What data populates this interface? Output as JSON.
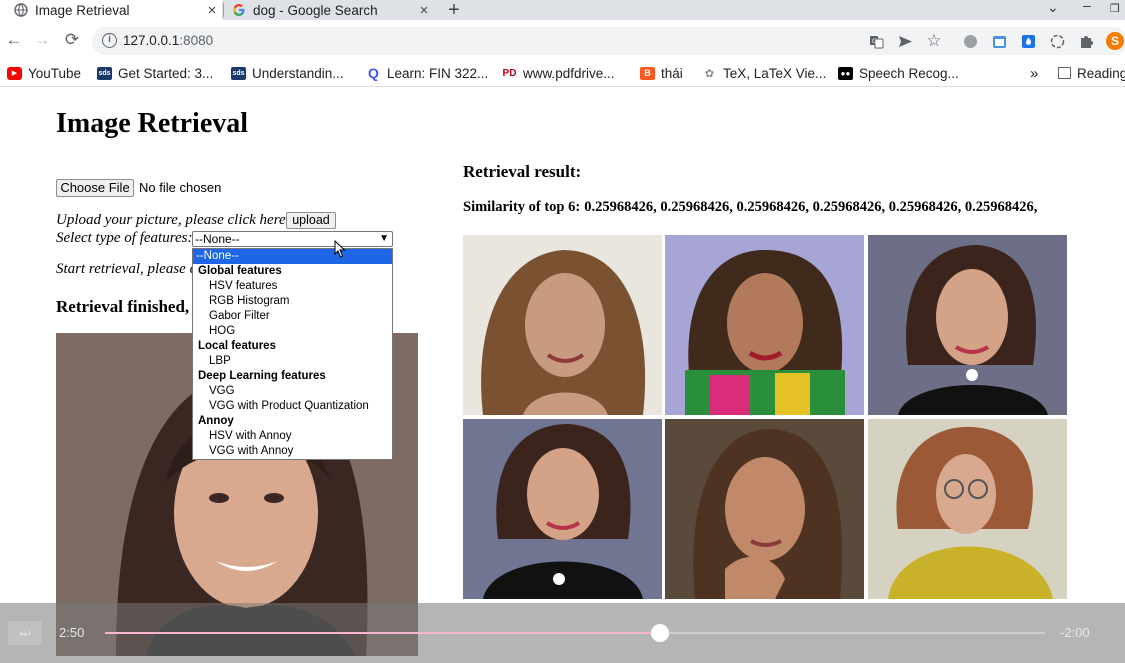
{
  "browser": {
    "tabs": [
      {
        "title": "Image Retrieval",
        "active": true,
        "close": "×",
        "icon": "globe-icon"
      },
      {
        "title": "dog - Google Search",
        "active": false,
        "close": "×",
        "icon": "google-g-icon"
      }
    ],
    "new_tab": "+",
    "url_host": "127.0.0.1",
    "url_port": ":8080",
    "bookmarks": [
      {
        "label": "YouTube",
        "icon": "youtube-icon",
        "color": "#ff0000"
      },
      {
        "label": "Get Started: 3...",
        "icon": "bookmark-favicon",
        "color": "#1a3a6b"
      },
      {
        "label": "Understandin...",
        "icon": "bookmark-favicon",
        "color": "#1a3a6b"
      },
      {
        "label": "Learn: FIN 322...",
        "icon": "quizlet-icon",
        "color": "#4255ff"
      },
      {
        "label": "www.pdfdrive...",
        "icon": "pdfdrive-icon",
        "color": "#b00020"
      },
      {
        "label": "thái",
        "icon": "blogger-icon",
        "color": "#ff5722"
      },
      {
        "label": "TeX, LaTeX Vie...",
        "icon": "tex-icon",
        "color": "#888888"
      },
      {
        "label": "Speech Recog...",
        "icon": "medium-icon",
        "color": "#000000"
      }
    ],
    "more_bookmarks": "»",
    "reading_list": "Reading"
  },
  "page": {
    "title": "Image Retrieval",
    "choose_file": "Choose File",
    "no_file": "No file chosen",
    "upload_label": "Upload your picture, please click here:",
    "upload_button": "upload",
    "select_label": "Select type of features:",
    "select_value": "--None--",
    "start_label": "Start retrieval, please c",
    "finished_label": "Retrieval finished,",
    "result_title": "Retrieval result:",
    "similarity_label": "Similarity of top 6:",
    "similarity_values": "0.25968426, 0.25968426, 0.25968426, 0.25968426, 0.25968426, 0.25968426,"
  },
  "dropdown": [
    {
      "type": "selected",
      "label": "--None--"
    },
    {
      "type": "group",
      "label": "Global features"
    },
    {
      "type": "option",
      "label": "HSV features"
    },
    {
      "type": "option",
      "label": "RGB Histogram"
    },
    {
      "type": "option",
      "label": "Gabor Filter"
    },
    {
      "type": "option",
      "label": "HOG"
    },
    {
      "type": "group",
      "label": "Local features"
    },
    {
      "type": "option",
      "label": "LBP"
    },
    {
      "type": "group",
      "label": "Deep Learning features"
    },
    {
      "type": "option",
      "label": "VGG"
    },
    {
      "type": "option",
      "label": "VGG with Product Quantization"
    },
    {
      "type": "group",
      "label": "Annoy"
    },
    {
      "type": "option",
      "label": "HSV with Annoy"
    },
    {
      "type": "option",
      "label": "VGG with Annoy"
    }
  ],
  "video": {
    "elapsed": "2:50",
    "remaining": "-2:00",
    "progress": 0.59
  },
  "profile_initial": "S"
}
